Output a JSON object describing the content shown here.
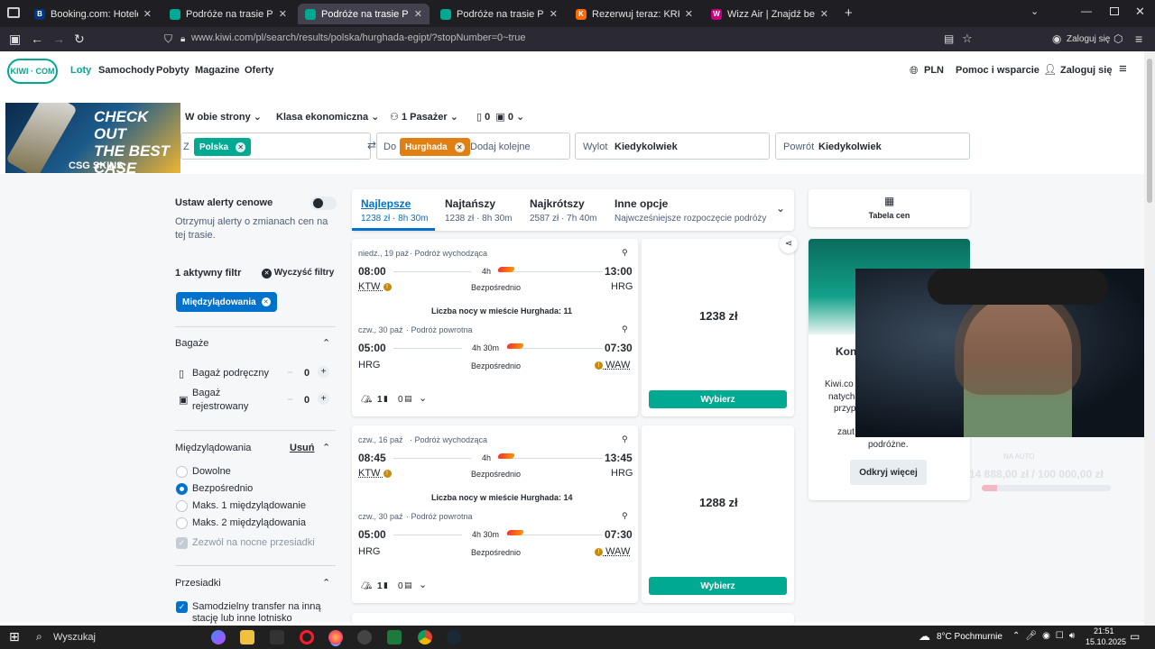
{
  "browser": {
    "tabs": [
      {
        "title": "Booking.com: Hotele – Egipt. Za",
        "fav": "B",
        "favcolor": "#003580"
      },
      {
        "title": "Podróże na trasie Polska – Egipt",
        "fav": "",
        "favcolor": "#00a991"
      },
      {
        "title": "Podróże na trasie Polska – Hurg",
        "fav": "",
        "favcolor": "#00a991"
      },
      {
        "title": "Podróże na trasie Polska – Szarm",
        "fav": "",
        "favcolor": "#00a991"
      },
      {
        "title": "Rezerwuj teraz: KRK,KTW – Egip",
        "fav": "K",
        "favcolor": "#ff6a00"
      },
      {
        "title": "Wizz Air | Znajdź bezpośrednio",
        "fav": "W",
        "favcolor": "#c6007e"
      }
    ],
    "url": "www.kiwi.com/pl/search/results/polska/hurghada-egipt/?stopNumber=0~true",
    "login": "Zaloguj się"
  },
  "header": {
    "logo": "KIWI · COM",
    "nav": [
      "Loty",
      "Samochody",
      "Pobyty",
      "Magazine",
      "Oferty"
    ],
    "currency": "PLN",
    "help": "Pomoc i wsparcie",
    "login": "Zaloguj się"
  },
  "ad": {
    "line1": "CHECK OUT",
    "line2": "THE BEST",
    "line3": "CASE",
    "brand": "CSG SKINS"
  },
  "search": {
    "trip": "W obie strony",
    "cabin": "Klasa ekonomiczna",
    "passengers": "1 Pasażer",
    "bag1": "0",
    "bag2": "0",
    "from_label": "Z",
    "from_chip": "Polska",
    "to_label": "Do",
    "to_chip": "Hurghada",
    "to_add": "Dodaj kolejne",
    "depart_label": "Wylot",
    "depart_value": "Kiedykolwiek",
    "return_label": "Powrót",
    "return_value": "Kiedykolwiek"
  },
  "sidebar": {
    "alerts_title": "Ustaw alerty cenowe",
    "alerts_desc": "Otrzymuj alerty o zmianach cen na tej trasie.",
    "active_filters": "1 aktywny filtr",
    "clear_filters": "Wyczyść filtry",
    "filter_chip": "Międzylądowania",
    "bags_title": "Bagaże",
    "cabin_bag": "Bagaż podręczny",
    "cabin_bag_count": "0",
    "checked_bag_1": "Bagaż",
    "checked_bag_2": "rejestrowany",
    "checked_bag_count": "0",
    "stops_title": "Międzylądowania",
    "stops_remove": "Usuń",
    "stops_options": [
      "Dowolne",
      "Bezpośrednio",
      "Maks. 1 międzylądowanie",
      "Maks. 2 międzylądowania"
    ],
    "stops_selected": 1,
    "overnight": "Zezwól na nocne przesiadki",
    "transfers_title": "Przesiadki",
    "self_transfer_1": "Samodzielny transfer na inną",
    "self_transfer_2": "stację lub inne lotnisko"
  },
  "sort": {
    "tabs": [
      {
        "label": "Najlepsze",
        "sub": "1238 zł · 8h 30m"
      },
      {
        "label": "Najtańszy",
        "sub": "1238 zł · 8h 30m"
      },
      {
        "label": "Najkrótszy",
        "sub": "2587 zł · 7h 40m"
      },
      {
        "label": "Inne opcje",
        "sub": "Najwcześniejsze rozpoczęcie podróży"
      }
    ]
  },
  "results": [
    {
      "out_date": "niedz., 19 paź",
      "out_label": "Podróż wychodząca",
      "out_dep": "08:00",
      "out_dur": "4h",
      "out_arr": "13:00",
      "out_from": "KTW",
      "out_type": "Bezpośrednio",
      "out_to": "HRG",
      "nights": "Liczba nocy w mieście Hurghada: 11",
      "ret_date": "czw., 30 paź",
      "ret_label": "Podróż powrotna",
      "ret_dep": "05:00",
      "ret_dur": "4h 30m",
      "ret_arr": "07:30",
      "ret_from": "HRG",
      "ret_type": "Bezpośrednio",
      "ret_to": "WAW",
      "seats": "1",
      "bags": "0",
      "price": "1238 zł",
      "button": "Wybierz"
    },
    {
      "out_date": "czw., 16 paź",
      "out_label": "Podróż wychodząca",
      "out_dep": "08:45",
      "out_dur": "4h",
      "out_arr": "13:45",
      "out_from": "KTW",
      "out_type": "Bezpośrednio",
      "out_to": "HRG",
      "nights": "Liczba nocy w mieście Hurghada: 14",
      "ret_date": "czw., 30 paź",
      "ret_label": "Podróż powrotna",
      "ret_dep": "05:00",
      "ret_dur": "4h 30m",
      "ret_arr": "07:30",
      "ret_from": "HRG",
      "ret_type": "Bezpośrednio",
      "ret_to": "WAW",
      "seats": "1",
      "bags": "0",
      "price": "1288 zł",
      "button": "Wybierz"
    }
  ],
  "right": {
    "price_table": "Tabela cen",
    "promo_title": "Kon",
    "promo_text1": "Kiwi.co",
    "promo_text2": "natychm",
    "promo_text3": "przyp",
    "promo_text4": "zaut",
    "promo_text5": "podróżne.",
    "discover": "Odkryj więcej",
    "donation_label": "NA AUTO",
    "donation_value": "14 888,00 zł / 100 000,00 zł",
    "donation_progress": 0.12
  },
  "taskbar": {
    "search": "Wyszukaj",
    "weather": "8°C  Pochmurnie",
    "time": "21:51",
    "date": "15.10.2025"
  }
}
